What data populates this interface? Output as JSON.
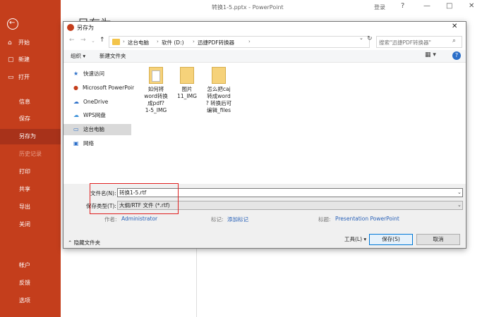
{
  "app": {
    "window_title": "转换1-5.pptx  -  PowerPoint",
    "login": "登录",
    "page_heading": "另存为",
    "win_buttons": [
      "?",
      "—",
      "□",
      "✕"
    ]
  },
  "sidebar": {
    "back_icon": "back-arrow-icon",
    "items": [
      {
        "label": "开始",
        "icon": "home-icon"
      },
      {
        "label": "新建",
        "icon": "new-file-icon"
      },
      {
        "label": "打开",
        "icon": "open-folder-icon"
      },
      {
        "label": "信息"
      },
      {
        "label": "保存"
      },
      {
        "label": "另存为",
        "selected": true
      },
      {
        "label": "历史记录",
        "disabled": true
      },
      {
        "label": "打印"
      },
      {
        "label": "共享"
      },
      {
        "label": "导出"
      },
      {
        "label": "关闭"
      },
      {
        "label": "帐户"
      },
      {
        "label": "反馈"
      },
      {
        "label": "选项"
      }
    ]
  },
  "dialog": {
    "title": "另存为",
    "close": "✕",
    "address": {
      "crumbs": [
        "这台电脑",
        "软件 (D:)",
        "迅捷PDF转换器"
      ],
      "separator": "›"
    },
    "search_placeholder": "搜索\"迅捷PDF转换器\"",
    "toolbar": {
      "organize": "组织 ▾",
      "new_folder": "新建文件夹",
      "view": "▦ ▾",
      "help": "?"
    },
    "nav": [
      {
        "label": "快速访问",
        "icon": "star-icon"
      },
      {
        "label": "Microsoft PowerPoint",
        "icon": "powerpoint-icon"
      },
      {
        "label": "OneDrive",
        "icon": "cloud-icon"
      },
      {
        "label": "WPS网盘",
        "icon": "wps-cloud-icon"
      },
      {
        "label": "这台电脑",
        "icon": "computer-icon",
        "selected": true
      },
      {
        "label": "网络",
        "icon": "network-icon"
      }
    ],
    "files": [
      {
        "name": "如何将\nword转换\n成pdf?\n1-5_IMG"
      },
      {
        "name": "图片\n11_IMG"
      },
      {
        "name": "怎么把caj\n转成word\n? 转换后可\n编辑_files"
      }
    ],
    "form": {
      "filename_label": "文件名(N):",
      "filename_value": "转换1-5.rtf",
      "filetype_label": "保存类型(T):",
      "filetype_value": "大纲/RTF 文件 (*.rtf)",
      "author_label": "作者:",
      "author_value": "Administrator",
      "tags_label": "标记:",
      "tags_value": "添加标记",
      "title_label": "标题:",
      "title_value": "Presentation PowerPoint"
    },
    "footer": {
      "hide_folders": "隐藏文件夹",
      "tools": "工具(L)  ▾",
      "save": "保存(S)",
      "cancel": "取消"
    }
  }
}
